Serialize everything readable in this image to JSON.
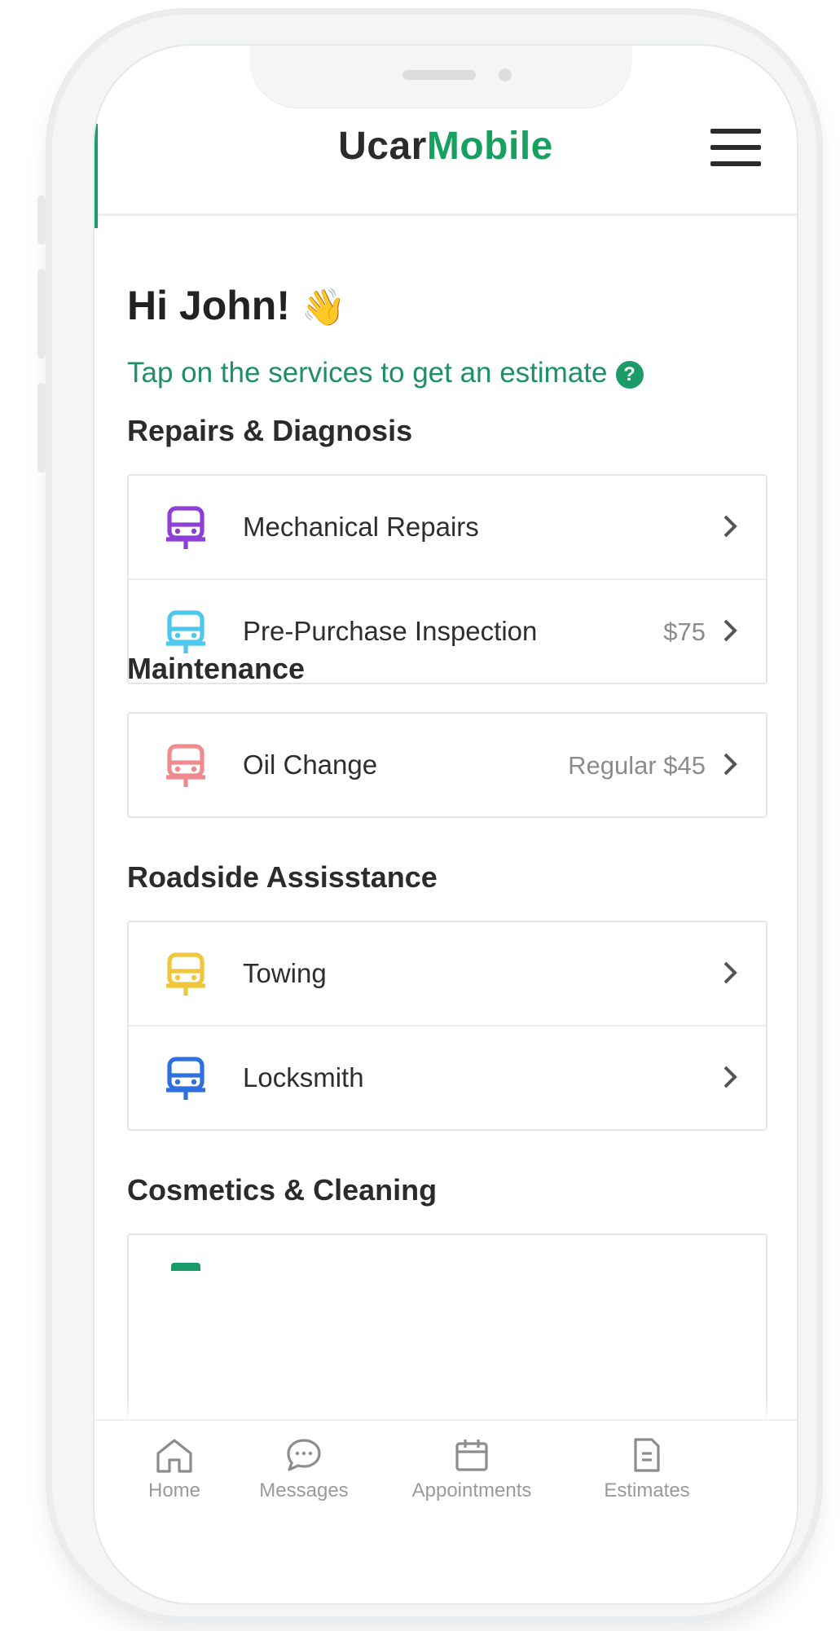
{
  "app": {
    "logo_part1": "Ucar",
    "logo_part2": "Mobile",
    "brand_color": "#18a060"
  },
  "greeting": {
    "text": "Hi John!",
    "emoji": "👋",
    "subtitle": "Tap on the services to get an estimate",
    "help_glyph": "?"
  },
  "sections": [
    {
      "title": "Repairs & Diagnosis",
      "items": [
        {
          "label": "Mechanical Repairs",
          "price": "",
          "icon": "car-icon",
          "color": "#8e3fd6"
        },
        {
          "label": "Pre-Purchase Inspection",
          "price": "$75",
          "icon": "car-icon",
          "color": "#4cc8ef"
        }
      ]
    },
    {
      "title": "Maintenance",
      "items": [
        {
          "label": "Oil Change",
          "price": "Regular $45",
          "icon": "car-icon",
          "color": "#ef8a8f"
        }
      ]
    },
    {
      "title": "Roadside Assisstance",
      "items": [
        {
          "label": "Towing",
          "price": "",
          "icon": "car-icon",
          "color": "#f0c63a"
        },
        {
          "label": "Locksmith",
          "price": "",
          "icon": "car-icon",
          "color": "#2f6fe0"
        }
      ]
    },
    {
      "title": "Cosmetics & Cleaning",
      "items": []
    }
  ],
  "tabs": [
    {
      "label": "Home",
      "icon": "home-icon"
    },
    {
      "label": "Messages",
      "icon": "chat-icon"
    },
    {
      "label": "Appointments",
      "icon": "calendar-icon"
    },
    {
      "label": "Estimates",
      "icon": "document-icon"
    }
  ]
}
